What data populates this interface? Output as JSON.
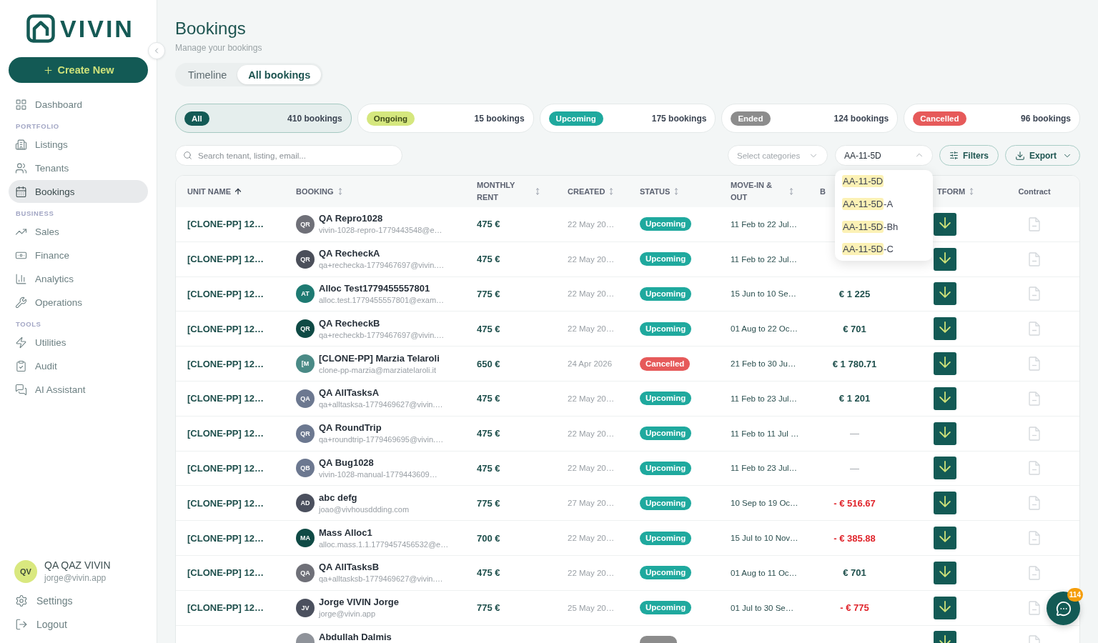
{
  "sidebar": {
    "brand": "VIVIN",
    "create_button": "Create New",
    "nav": [
      {
        "items": [
          {
            "label": "Dashboard",
            "selected": false
          }
        ]
      },
      {
        "title": "PORTFOLIO",
        "items": [
          {
            "label": "Listings",
            "selected": false
          },
          {
            "label": "Tenants",
            "selected": false
          },
          {
            "label": "Bookings",
            "selected": true
          }
        ]
      },
      {
        "title": "BUSINESS",
        "items": [
          {
            "label": "Sales",
            "selected": false
          },
          {
            "label": "Finance",
            "selected": false
          },
          {
            "label": "Analytics",
            "selected": false
          },
          {
            "label": "Operations",
            "selected": false
          }
        ]
      },
      {
        "title": "TOOLS",
        "items": [
          {
            "label": "Utilities",
            "selected": false
          },
          {
            "label": "Audit",
            "selected": false
          },
          {
            "label": "AI Assistant",
            "selected": false
          }
        ]
      }
    ],
    "user": {
      "initials": "QV",
      "name": "QA QAZ VIVIN",
      "email": "jorge@vivin.app"
    },
    "footer_links": [
      {
        "label": "Settings"
      },
      {
        "label": "Logout"
      }
    ]
  },
  "header": {
    "title": "Bookings",
    "subtitle": "Manage your bookings"
  },
  "view_tabs": [
    {
      "label": "Timeline",
      "selected": false
    },
    {
      "label": "All bookings",
      "selected": true
    }
  ],
  "status_cards": [
    {
      "kind": "all",
      "label": "All",
      "count": "410 bookings",
      "selected": true
    },
    {
      "kind": "ongoing",
      "label": "Ongoing",
      "count": "15 bookings",
      "selected": false
    },
    {
      "kind": "upcoming",
      "label": "Upcoming",
      "count": "175 bookings",
      "selected": false
    },
    {
      "kind": "ended",
      "label": "Ended",
      "count": "124 bookings",
      "selected": false
    },
    {
      "kind": "cancelled",
      "label": "Cancelled",
      "count": "96 bookings",
      "selected": false
    }
  ],
  "filters": {
    "search": {
      "placeholder": "Search tenant, listing, email..."
    },
    "category_select": {
      "placeholder": "Select categories"
    },
    "unit_search": {
      "value": "AA-11-5D",
      "expanded": true,
      "options": [
        {
          "match": "AA-11-5D"
        },
        {
          "match": "AA-11-5D",
          "rest": "-A"
        },
        {
          "match": "AA-11-5D",
          "rest": "-Bh"
        },
        {
          "match": "AA-11-5D",
          "rest": "-C"
        }
      ]
    },
    "buttons": [
      {
        "kind": "filters",
        "label": "Filters"
      },
      {
        "kind": "export",
        "label": "Export"
      }
    ]
  },
  "table": {
    "columns": [
      {
        "label": "UNIT NAME",
        "sortable": true,
        "sorted": true
      },
      {
        "label": "BOOKING",
        "sortable": true,
        "sorted": false
      },
      {
        "label": "MONTHLY RENT",
        "sortable": true,
        "sorted": false
      },
      {
        "label": "CREATED",
        "sortable": true,
        "sorted": false
      },
      {
        "label": "STATUS",
        "sortable": true,
        "sorted": false
      },
      {
        "label": "MOVE-IN & OUT",
        "sortable": true,
        "sorted": false
      },
      {
        "label": "B"
      },
      {
        "label": "TFORM",
        "sortable": true,
        "sorted": false
      },
      {
        "label": "Contract",
        "sortable": false,
        "sorted": false
      }
    ],
    "rows": [
      {
        "unit": "[CLONE-PP] 12…",
        "tenant": {
          "initials": "QR",
          "color": "#6f7078",
          "name": "QA Repro1028",
          "email": "vivin-1028-repro-1779443548@e…"
        },
        "rent": "475 €",
        "created": "22 May 20…",
        "status": {
          "kind": "upcoming",
          "label": "Upcoming"
        },
        "stay": "11 Feb to 22 Jul…"
      },
      {
        "unit": "[CLONE-PP] 12…",
        "tenant": {
          "initials": "QR",
          "color": "#4b4f5a",
          "name": "QA RecheckA",
          "email": "qa+rechecka-1779467697@vivin.…"
        },
        "rent": "475 €",
        "created": "22 May 20…",
        "status": {
          "kind": "upcoming",
          "label": "Upcoming"
        },
        "stay": "11 Feb to 22 Jul…"
      },
      {
        "unit": "[CLONE-PP] 12…",
        "tenant": {
          "initials": "AT",
          "color": "#1e7a72",
          "name": "Alloc Test1779455557801",
          "email": "alloc.test.1779455557801@exam…"
        },
        "rent": "775 €",
        "created": "22 May 20…",
        "status": {
          "kind": "upcoming",
          "label": "Upcoming"
        },
        "stay": "15 Jun to 10 Se…",
        "balance": {
          "kind": "credit",
          "text": "€ 1 225"
        }
      },
      {
        "unit": "[CLONE-PP] 12…",
        "tenant": {
          "initials": "QR",
          "color": "#0f4a45",
          "name": "QA RecheckB",
          "email": "qa+recheckb-1779467697@vivin.…"
        },
        "rent": "475 €",
        "created": "22 May 20…",
        "status": {
          "kind": "upcoming",
          "label": "Upcoming"
        },
        "stay": "01 Aug to 22 Oc…",
        "balance": {
          "kind": "credit",
          "text": "€ 701"
        }
      },
      {
        "unit": "[CLONE-PP] 12…",
        "tenant": {
          "initials": "[M",
          "color": "#4a8a86",
          "name": "[CLONE-PP] Marzia Telaroli",
          "email": "clone-pp-marzia@marziatelaroli.it"
        },
        "rent": "650 €",
        "created": "24 Apr 2026",
        "status": {
          "kind": "cancelled",
          "label": "Cancelled"
        },
        "stay": "21 Feb to 30 Ju…",
        "balance": {
          "kind": "credit",
          "text": "€ 1 780.71"
        }
      },
      {
        "unit": "[CLONE-PP] 12…",
        "tenant": {
          "initials": "QA",
          "color": "#6c7890",
          "name": "QA AllTasksA",
          "email": "qa+alltasksa-1779469627@vivin.…"
        },
        "rent": "475 €",
        "created": "22 May 20…",
        "status": {
          "kind": "upcoming",
          "label": "Upcoming"
        },
        "stay": "11 Feb to 23 Jul…",
        "balance": {
          "kind": "credit",
          "text": "€ 1 201"
        }
      },
      {
        "unit": "[CLONE-PP] 12…",
        "tenant": {
          "initials": "QR",
          "color": "#6c7890",
          "name": "QA RoundTrip",
          "email": "qa+roundtrip-1779469695@vivin.…"
        },
        "rent": "475 €",
        "created": "22 May 20…",
        "status": {
          "kind": "upcoming",
          "label": "Upcoming"
        },
        "stay": "11 Feb to 11 Jul …",
        "balance": {
          "kind": "empty",
          "text": "—"
        }
      },
      {
        "unit": "[CLONE-PP] 12…",
        "tenant": {
          "initials": "QB",
          "color": "#6c7890",
          "name": "QA Bug1028",
          "email": "vivin-1028-manual-1779443609…"
        },
        "rent": "475 €",
        "created": "22 May 20…",
        "status": {
          "kind": "upcoming",
          "label": "Upcoming"
        },
        "stay": "11 Feb to 23 Jul…",
        "balance": {
          "kind": "empty",
          "text": "—"
        }
      },
      {
        "unit": "[CLONE-PP] 12…",
        "tenant": {
          "initials": "AD",
          "color": "#4b505e",
          "name": "abc defg",
          "email": "joao@vivhousddding.com"
        },
        "rent": "775 €",
        "created": "27 May 20…",
        "status": {
          "kind": "upcoming",
          "label": "Upcoming"
        },
        "stay": "10 Sep to 19 Oc…",
        "balance": {
          "kind": "debit",
          "text": "- € 516.67"
        }
      },
      {
        "unit": "[CLONE-PP] 12…",
        "tenant": {
          "initials": "MA",
          "color": "#0f4a45",
          "name": "Mass Alloc1",
          "email": "alloc.mass.1.1.1779457456532@e…"
        },
        "rent": "700 €",
        "created": "22 May 20…",
        "status": {
          "kind": "upcoming",
          "label": "Upcoming"
        },
        "stay": "15 Jul to 10 Nov…",
        "balance": {
          "kind": "debit",
          "text": "- € 385.88"
        }
      },
      {
        "unit": "[CLONE-PP] 12…",
        "tenant": {
          "initials": "QA",
          "color": "#6f7078",
          "name": "QA AllTasksB",
          "email": "qa+alltasksb-1779469627@vivin.…"
        },
        "rent": "475 €",
        "created": "22 May 20…",
        "status": {
          "kind": "upcoming",
          "label": "Upcoming"
        },
        "stay": "01 Aug to 11 Oc…",
        "balance": {
          "kind": "credit",
          "text": "€ 701"
        }
      },
      {
        "unit": "[CLONE-PP] 12…",
        "tenant": {
          "initials": "JV",
          "color": "#4b505e",
          "name": "Jorge VIVIN Jorge",
          "email": "jorge@vivin.app"
        },
        "rent": "775 €",
        "created": "25 May 20…",
        "status": {
          "kind": "upcoming",
          "label": "Upcoming"
        },
        "stay": "01 Jul to 30 Se…",
        "balance": {
          "kind": "debit",
          "text": "- € 775"
        }
      },
      {
        "tenant": {
          "color": "#8f939a",
          "name": "Abdullah Dalmis"
        },
        "status": {
          "kind": "ended"
        }
      }
    ]
  },
  "chat": {
    "badge": "114"
  }
}
